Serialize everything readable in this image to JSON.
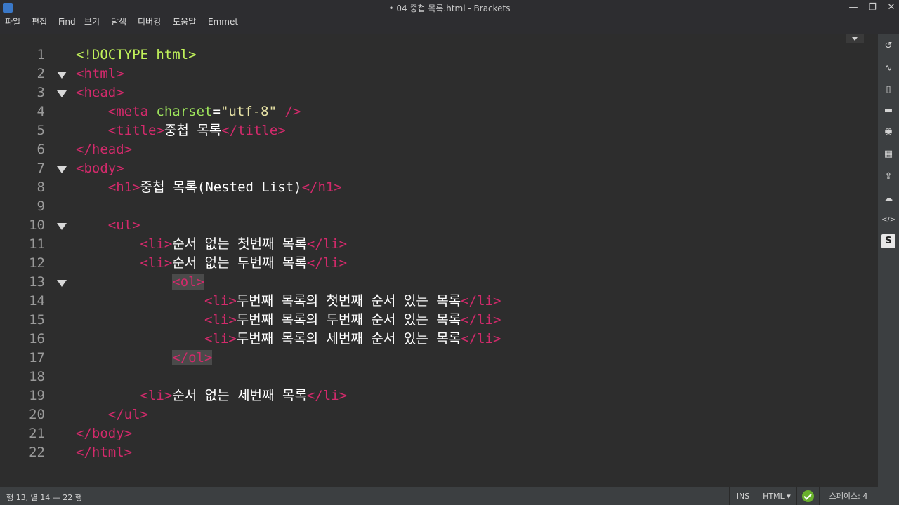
{
  "window": {
    "title": "• 04 중첩 목록.html - Brackets",
    "minimize": "—",
    "restore": "❐",
    "close": "✕"
  },
  "menu": [
    "파일",
    "편집",
    "Find",
    "보기",
    "탐색",
    "디버깅",
    "도움말",
    "Emmet"
  ],
  "editor": {
    "lines": [
      {
        "n": "1"
      },
      {
        "n": "2"
      },
      {
        "n": "3"
      },
      {
        "n": "4"
      },
      {
        "n": "5"
      },
      {
        "n": "6"
      },
      {
        "n": "7"
      },
      {
        "n": "8"
      },
      {
        "n": "9"
      },
      {
        "n": "10"
      },
      {
        "n": "11"
      },
      {
        "n": "12"
      },
      {
        "n": "13"
      },
      {
        "n": "14"
      },
      {
        "n": "15"
      },
      {
        "n": "16"
      },
      {
        "n": "17"
      },
      {
        "n": "18"
      },
      {
        "n": "19"
      },
      {
        "n": "20"
      },
      {
        "n": "21"
      },
      {
        "n": "22"
      }
    ],
    "text": {
      "l1": "<!DOCTYPE html>",
      "l2": "<html>",
      "l3": "<head>",
      "l4_open": "<meta",
      "l4_attr": "charset",
      "l4_eq": "=",
      "l4_val": "\"utf-8\"",
      "l4_close": "/>",
      "l5_open": "<title>",
      "l5_text": "중첩 목록",
      "l5_close": "</title>",
      "l6": "</head>",
      "l7": "<body>",
      "l8_open": "<h1>",
      "l8_text": "중첩 목록(Nested List)",
      "l8_close": "</h1>",
      "l10": "<ul>",
      "li_open": "<li>",
      "li_close": "</li>",
      "l11_text": "순서 없는 첫번째 목록",
      "l12_text": "순서 없는 두번째 목록",
      "l13": "<ol>",
      "l14_text": "두번째 목록의 첫번째 순서 있는 목록",
      "l15_text": "두번째 목록의 두번째 순서 있는 목록",
      "l16_text": "두번째 목록의 세번째 순서 있는 목록",
      "l17": "</ol>",
      "l19_text": "순서 없는 세번째 목록",
      "l20": "</ul>",
      "l21": "</body>",
      "l22": "</html>"
    }
  },
  "sidebar": {
    "icons": [
      {
        "name": "live-preview-icon",
        "glyph": "↺"
      },
      {
        "name": "trend-icon",
        "glyph": "∿"
      },
      {
        "name": "file-search-icon",
        "glyph": "▯"
      },
      {
        "name": "extension-icon",
        "glyph": "▬"
      },
      {
        "name": "theme-icon",
        "glyph": "◉"
      },
      {
        "name": "checker-icon",
        "glyph": "▦"
      },
      {
        "name": "upload-icon",
        "glyph": "⇪"
      },
      {
        "name": "cloud-icon",
        "glyph": "☁"
      },
      {
        "name": "code-icon",
        "glyph": "</>"
      },
      {
        "name": "s-icon",
        "glyph": "S"
      }
    ]
  },
  "status": {
    "position": "행 13, 열 14 — 22 행",
    "ins": "INS",
    "language": "HTML ▾",
    "indent": "스페이스: 4"
  },
  "colors": {
    "tag": "#d22a6b",
    "doctype": "#c1f25a",
    "attribute": "#9ee55c",
    "string": "#e8e3a6",
    "editor_bg": "#2d2d2d",
    "lint_ok": "#69b02c"
  }
}
